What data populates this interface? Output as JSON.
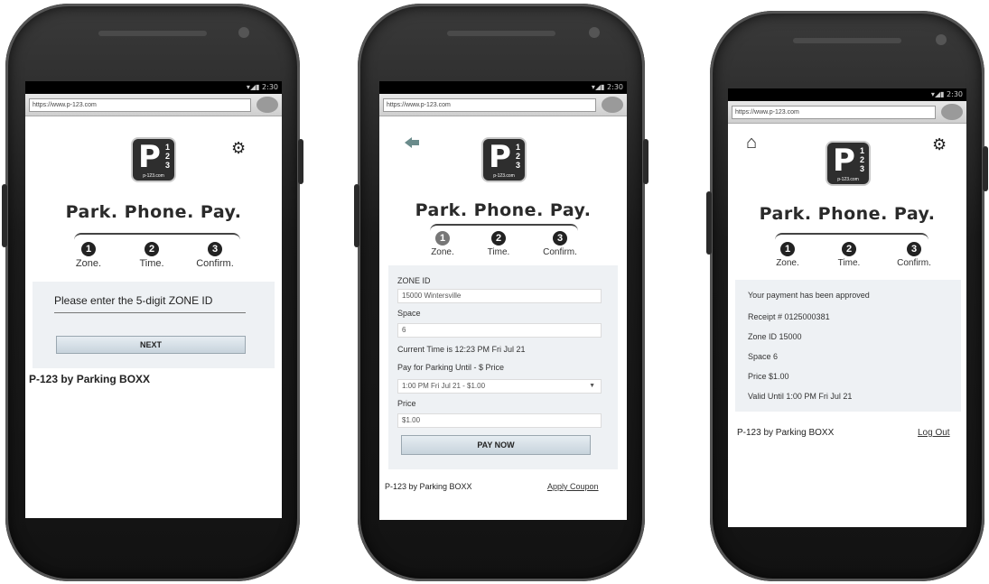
{
  "common": {
    "tagline": "Park. Phone. Pay.",
    "steps": [
      "Zone.",
      "Time.",
      "Confirm."
    ],
    "step_numbers": [
      "1",
      "2",
      "3"
    ],
    "logo_letter": "P",
    "logo_numbers": [
      "1",
      "2",
      "3"
    ],
    "logo_domain": "p-123.com",
    "status_icons": "▾◢▮ 2:30",
    "url": "https://www.p-123.com"
  },
  "screen1": {
    "prompt": "Please enter the 5-digit ZONE ID",
    "next_label": "NEXT",
    "footer": "P-123 by Parking BOXX",
    "gear_icon": "gear-icon"
  },
  "screen2": {
    "zone_label": "ZONE ID",
    "zone_value": "15000 Wintersville",
    "space_label": "Space",
    "space_value": "6",
    "current_time": "Current Time is 12:23 PM Fri Jul 21",
    "pay_until_label": "Pay for Parking Until - $ Price",
    "pay_until_value": "1:00 PM Fri Jul 21 - $1.00",
    "price_label": "Price",
    "price_value": "$1.00",
    "pay_now_label": "PAY NOW",
    "footer": "P-123 by Parking BOXX",
    "coupon_link": "Apply Coupon"
  },
  "screen3": {
    "approved": "Your payment has been approved",
    "receipt": "Receipt # 0125000381",
    "zone": "Zone ID 15000",
    "space": "Space 6",
    "price": "Price $1.00",
    "valid": "Valid Until 1:00 PM Fri Jul 21",
    "footer": "P-123 by Parking BOXX",
    "logout": "Log Out"
  }
}
